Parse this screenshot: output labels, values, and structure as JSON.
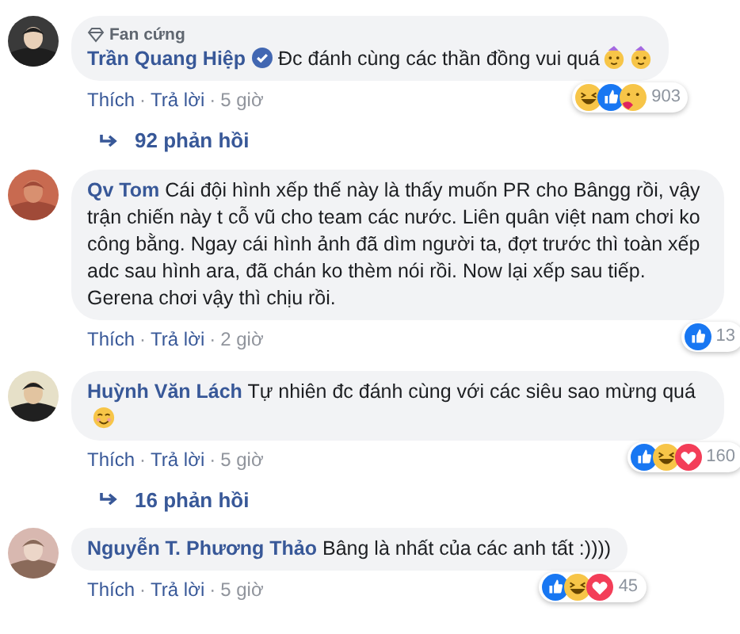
{
  "separator": "·",
  "comments": [
    {
      "badge": "Fan cứng",
      "author": "Trần Quang Hiệp",
      "verified": true,
      "text": "Đc đánh cùng các thần đồng vui quá",
      "emojis": [
        {
          "kind": "party"
        },
        {
          "kind": "party"
        }
      ],
      "reactions": [
        {
          "kind": "haha"
        },
        {
          "kind": "like"
        },
        {
          "kind": "care"
        }
      ],
      "reaction_count": "903",
      "actions": [
        "Thích",
        "Trả lời",
        "5 giờ"
      ],
      "replies": "92 phản hồi"
    },
    {
      "author": "Qv Tom",
      "verified": false,
      "text": "Cái đội hình xếp thế này là thấy muốn PR cho Bângg rồi, vậy trận chiến này t cỗ vũ cho team các nước. Liên quân việt nam chơi ko công bằng. Ngay cái hình ảnh đã dìm người ta, đợt trước thì toàn xếp adc sau hình ara, đã chán ko thèm nói rồi. Now lại xếp sau tiếp. Gerena chơi vậy thì chịu rồi.",
      "reactions": [
        {
          "kind": "like"
        }
      ],
      "reaction_count": "13",
      "actions": [
        "Thích",
        "Trả lời",
        "2 giờ"
      ]
    },
    {
      "author": "Huỳnh Văn Lách",
      "verified": false,
      "text": "Tự nhiên đc đánh cùng với các siêu sao mừng quá",
      "emojis": [
        {
          "kind": "smile"
        }
      ],
      "reactions": [
        {
          "kind": "like"
        },
        {
          "kind": "haha"
        },
        {
          "kind": "love"
        }
      ],
      "reaction_count": "160",
      "actions": [
        "Thích",
        "Trả lời",
        "5 giờ"
      ],
      "replies": "16 phản hồi"
    },
    {
      "author": "Nguyễn T. Phương Thảo",
      "verified": false,
      "text": "Bâng là nhất của các anh tất :))))",
      "reactions": [
        {
          "kind": "like"
        },
        {
          "kind": "haha"
        },
        {
          "kind": "love"
        }
      ],
      "reaction_count": "45",
      "actions": [
        "Thích",
        "Trả lời",
        "5 giờ"
      ]
    }
  ]
}
